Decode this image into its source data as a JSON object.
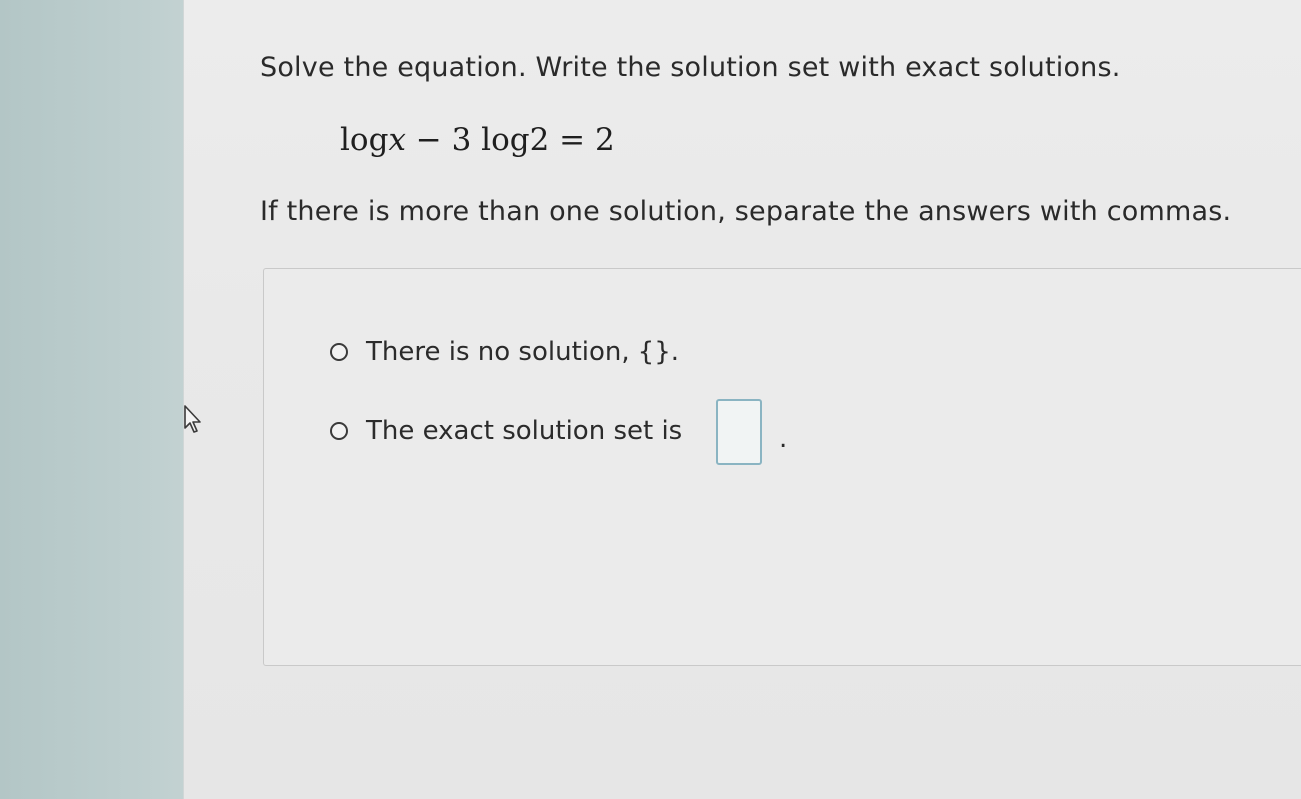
{
  "question": {
    "prompt": "Solve the equation. Write the solution set with exact solutions.",
    "equation": {
      "part1": "log",
      "var": "x",
      "part2": " − 3 log2 = 2"
    },
    "instruction": "If there is more than one solution, separate the answers with commas."
  },
  "answer_options": [
    {
      "label": "There is no solution,",
      "symbol": "{}",
      "suffix": "."
    },
    {
      "label": "The exact solution set is",
      "suffix": "."
    }
  ],
  "answer_input": {
    "value": ""
  },
  "icons": {
    "cursor": "pointer-arrow-icon",
    "radio": "radio-button-icon"
  }
}
